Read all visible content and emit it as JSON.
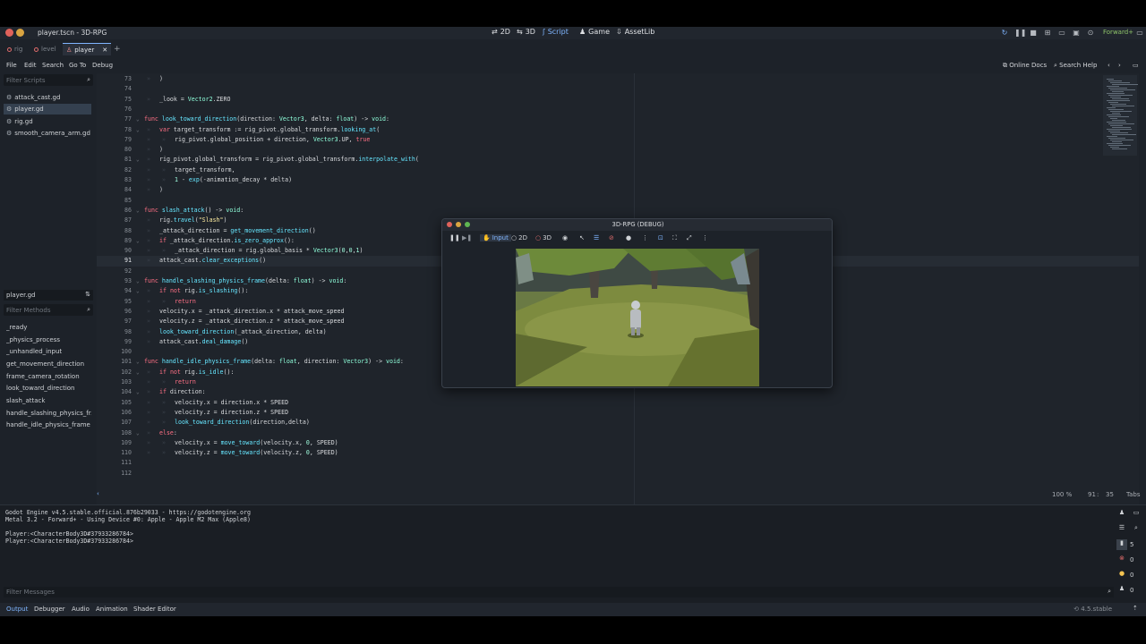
{
  "window": {
    "title": "player.tscn - 3D-RPG"
  },
  "main_nav": [
    {
      "label": "2D",
      "icon": "2d-icon"
    },
    {
      "label": "3D",
      "icon": "3d-icon"
    },
    {
      "label": "Script",
      "icon": "script-icon"
    },
    {
      "label": "Game",
      "icon": "game-icon"
    },
    {
      "label": "AssetLib",
      "icon": "assetlib-icon"
    }
  ],
  "renderer": "Forward+",
  "scene_tabs": [
    {
      "label": "rig"
    },
    {
      "label": "level"
    },
    {
      "label": "player"
    }
  ],
  "menu": [
    "File",
    "Edit",
    "Search",
    "Go To",
    "Debug"
  ],
  "menu_right": {
    "docs": "Online Docs",
    "help": "Search Help"
  },
  "scripts": {
    "filter_placeholder": "Filter Scripts",
    "items": [
      "attack_cast.gd",
      "player.gd",
      "rig.gd",
      "smooth_camera_arm.gd"
    ]
  },
  "methods": {
    "title": "player.gd",
    "filter_placeholder": "Filter Methods",
    "items": [
      "_ready",
      "_physics_process",
      "_unhandled_input",
      "get_movement_direction",
      "frame_camera_rotation",
      "look_toward_direction",
      "slash_attack",
      "handle_slashing_physics_fr...",
      "handle_idle_physics_frame"
    ]
  },
  "code_lines": [
    {
      "n": "73",
      "t": "\t)"
    },
    {
      "n": "74",
      "t": ""
    },
    {
      "n": "75",
      "t": "\t_look = Vector2.ZERO"
    },
    {
      "n": "76",
      "t": ""
    },
    {
      "n": "77",
      "t": "func look_toward_direction(direction: Vector3, delta: float) -> void:"
    },
    {
      "n": "78",
      "t": "\tvar target_transform := rig_pivot.global_transform.looking_at("
    },
    {
      "n": "79",
      "t": "\t\trig_pivot.global_position + direction, Vector3.UP, true"
    },
    {
      "n": "80",
      "t": "\t)"
    },
    {
      "n": "81",
      "t": "\trig_pivot.global_transform = rig_pivot.global_transform.interpolate_with("
    },
    {
      "n": "82",
      "t": "\t\ttarget_transform,"
    },
    {
      "n": "83",
      "t": "\t\t1 - exp(-animation_decay * delta)"
    },
    {
      "n": "84",
      "t": "\t)"
    },
    {
      "n": "85",
      "t": ""
    },
    {
      "n": "86",
      "t": "func slash_attack() -> void:"
    },
    {
      "n": "87",
      "t": "\trig.travel(\"Slash\")"
    },
    {
      "n": "88",
      "t": "\t_attack_direction = get_movement_direction()"
    },
    {
      "n": "89",
      "t": "\tif _attack_direction.is_zero_approx():"
    },
    {
      "n": "90",
      "t": "\t\t_attack_direction = rig.global_basis * Vector3(0,0,1)"
    },
    {
      "n": "91",
      "t": "\tattack_cast.clear_exceptions()"
    },
    {
      "n": "92",
      "t": ""
    },
    {
      "n": "93",
      "t": "func handle_slashing_physics_frame(delta: float) -> void:"
    },
    {
      "n": "94",
      "t": "\tif not rig.is_slashing():"
    },
    {
      "n": "95",
      "t": "\t\treturn"
    },
    {
      "n": "96",
      "t": "\tvelocity.x = _attack_direction.x * attack_move_speed"
    },
    {
      "n": "97",
      "t": "\tvelocity.z = _attack_direction.z * attack_move_speed"
    },
    {
      "n": "98",
      "t": "\tlook_toward_direction(_attack_direction, delta)"
    },
    {
      "n": "99",
      "t": "\tattack_cast.deal_damage()"
    },
    {
      "n": "100",
      "t": ""
    },
    {
      "n": "101",
      "t": "func handle_idle_physics_frame(delta: float, direction: Vector3) -> void:"
    },
    {
      "n": "102",
      "t": "\tif not rig.is_idle():"
    },
    {
      "n": "103",
      "t": "\t\treturn"
    },
    {
      "n": "104",
      "t": "\tif direction:"
    },
    {
      "n": "105",
      "t": "\t\tvelocity.x = direction.x * SPEED"
    },
    {
      "n": "106",
      "t": "\t\tvelocity.z = direction.z * SPEED"
    },
    {
      "n": "107",
      "t": "\t\tlook_toward_direction(direction,delta)"
    },
    {
      "n": "108",
      "t": "\telse:"
    },
    {
      "n": "109",
      "t": "\t\tvelocity.x = move_toward(velocity.x, 0, SPEED)"
    },
    {
      "n": "110",
      "t": "\t\tvelocity.z = move_toward(velocity.z, 0, SPEED)"
    },
    {
      "n": "111",
      "t": ""
    },
    {
      "n": "112",
      "t": ""
    }
  ],
  "current_line": "91",
  "editor_status": {
    "zoom": "100 %",
    "line": "91",
    "col": "35",
    "indent": "Tabs"
  },
  "output": {
    "lines": [
      "Godot Engine v4.5.stable.official.876b29033 - https://godotengine.org",
      "Metal 3.2 - Forward+ - Using Device #0: Apple - Apple M2 Max (Apple8)",
      "",
      "Player:<CharacterBody3D#37933286784>",
      "Player:<CharacterBody3D#37933286784>"
    ],
    "filter_placeholder": "Filter Messages",
    "counts": {
      "messages": "5",
      "errors": "0",
      "warnings": "0",
      "other": "0"
    }
  },
  "bottom_tabs": [
    "Output",
    "Debugger",
    "Audio",
    "Animation",
    "Shader Editor"
  ],
  "version": "4.5.stable",
  "game_window": {
    "title": "3D-RPG (DEBUG)",
    "toolbar": {
      "input": "Input",
      "mode_2d": "2D",
      "mode_3d": "3D"
    }
  },
  "colors": {
    "accent": "#7fb5ff",
    "keyword": "#ff7085",
    "function": "#66e6ff",
    "class": "#8fffdb",
    "string": "#ffeda1",
    "number": "#a1ffe0",
    "error": "#e06c6c",
    "warning": "#f5c451"
  }
}
